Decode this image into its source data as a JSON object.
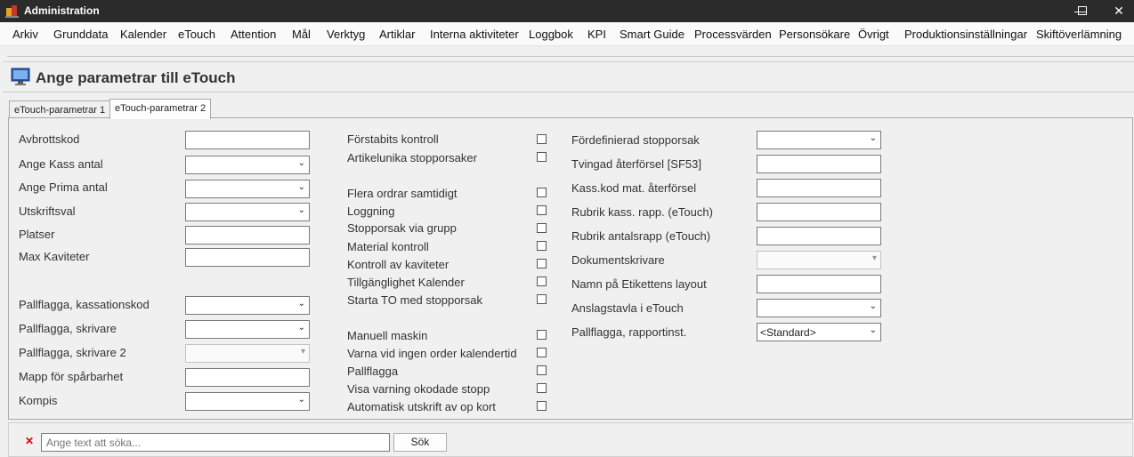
{
  "window": {
    "title": "Administration",
    "minimize": "—",
    "maximize": "☐",
    "close": "✕"
  },
  "menu": [
    "Arkiv",
    "Grunddata",
    "Kalender",
    "eTouch",
    "Attention",
    "Mål",
    "Verktyg",
    "Artiklar",
    "Interna aktiviteter",
    "Loggbok",
    "KPI",
    "Smart Guide",
    "Processvärden",
    "Personsökare",
    "Övrigt",
    "Produktionsinställningar",
    "Skiftöverlämning"
  ],
  "page": {
    "title": "Ange parametrar till eTouch"
  },
  "tabs": [
    {
      "label": "eTouch-parametrar 1",
      "active": false
    },
    {
      "label": "eTouch-parametrar 2",
      "active": true
    }
  ],
  "col1": {
    "avbrottskod": "Avbrottskod",
    "kass_antal": "Ange Kass antal",
    "prima_antal": "Ange Prima antal",
    "utskriftsval": "Utskriftsval",
    "platser": "Platser",
    "max_kaviteter": "Max Kaviteter",
    "pall_kass": "Pallflagga, kassationskod",
    "pall_skrivare": "Pallflagga, skrivare",
    "pall_skrivare2": "Pallflagga, skrivare 2",
    "mapp": "Mapp för spårbarhet",
    "kompis": "Kompis"
  },
  "col2": {
    "forstabits": "Förstabits kontroll",
    "artikelunika": "Artikelunika stopporsaker",
    "flera_ordrar": "Flera ordrar samtidigt",
    "loggning": "Loggning",
    "stopporsak_grupp": "Stopporsak via grupp",
    "material": "Material kontroll",
    "kontroll_kav": "Kontroll av kaviteter",
    "tillganglighet": "Tillgänglighet Kalender",
    "starta_to": "Starta TO med stopporsak",
    "manuell": "Manuell maskin",
    "varna": "Varna vid ingen order kalendertid",
    "pallflagga": "Pallflagga",
    "visa_varning": "Visa varning okodade stopp",
    "auto_utskrift": "Automatisk utskrift av op kort"
  },
  "col3": {
    "fordef_stopp": "Fördefinierad stopporsak",
    "tvingad": "Tvingad återförsel [SF53]",
    "kass_kod": "Kass.kod mat. återförsel",
    "rubrik_kass": "Rubrik kass. rapp. (eTouch)",
    "rubrik_antal": "Rubrik antalsrapp (eTouch)",
    "dokumentskrivare": "Dokumentskrivare",
    "namn_etikett": "Namn på Etikettens layout",
    "anslagstavla": "Anslagstavla i eTouch",
    "pall_rapport": "Pallflagga, rapportinst.",
    "pall_rapport_value": "<Standard>"
  },
  "search": {
    "placeholder": "Ange text att söka...",
    "button": "Sök"
  }
}
